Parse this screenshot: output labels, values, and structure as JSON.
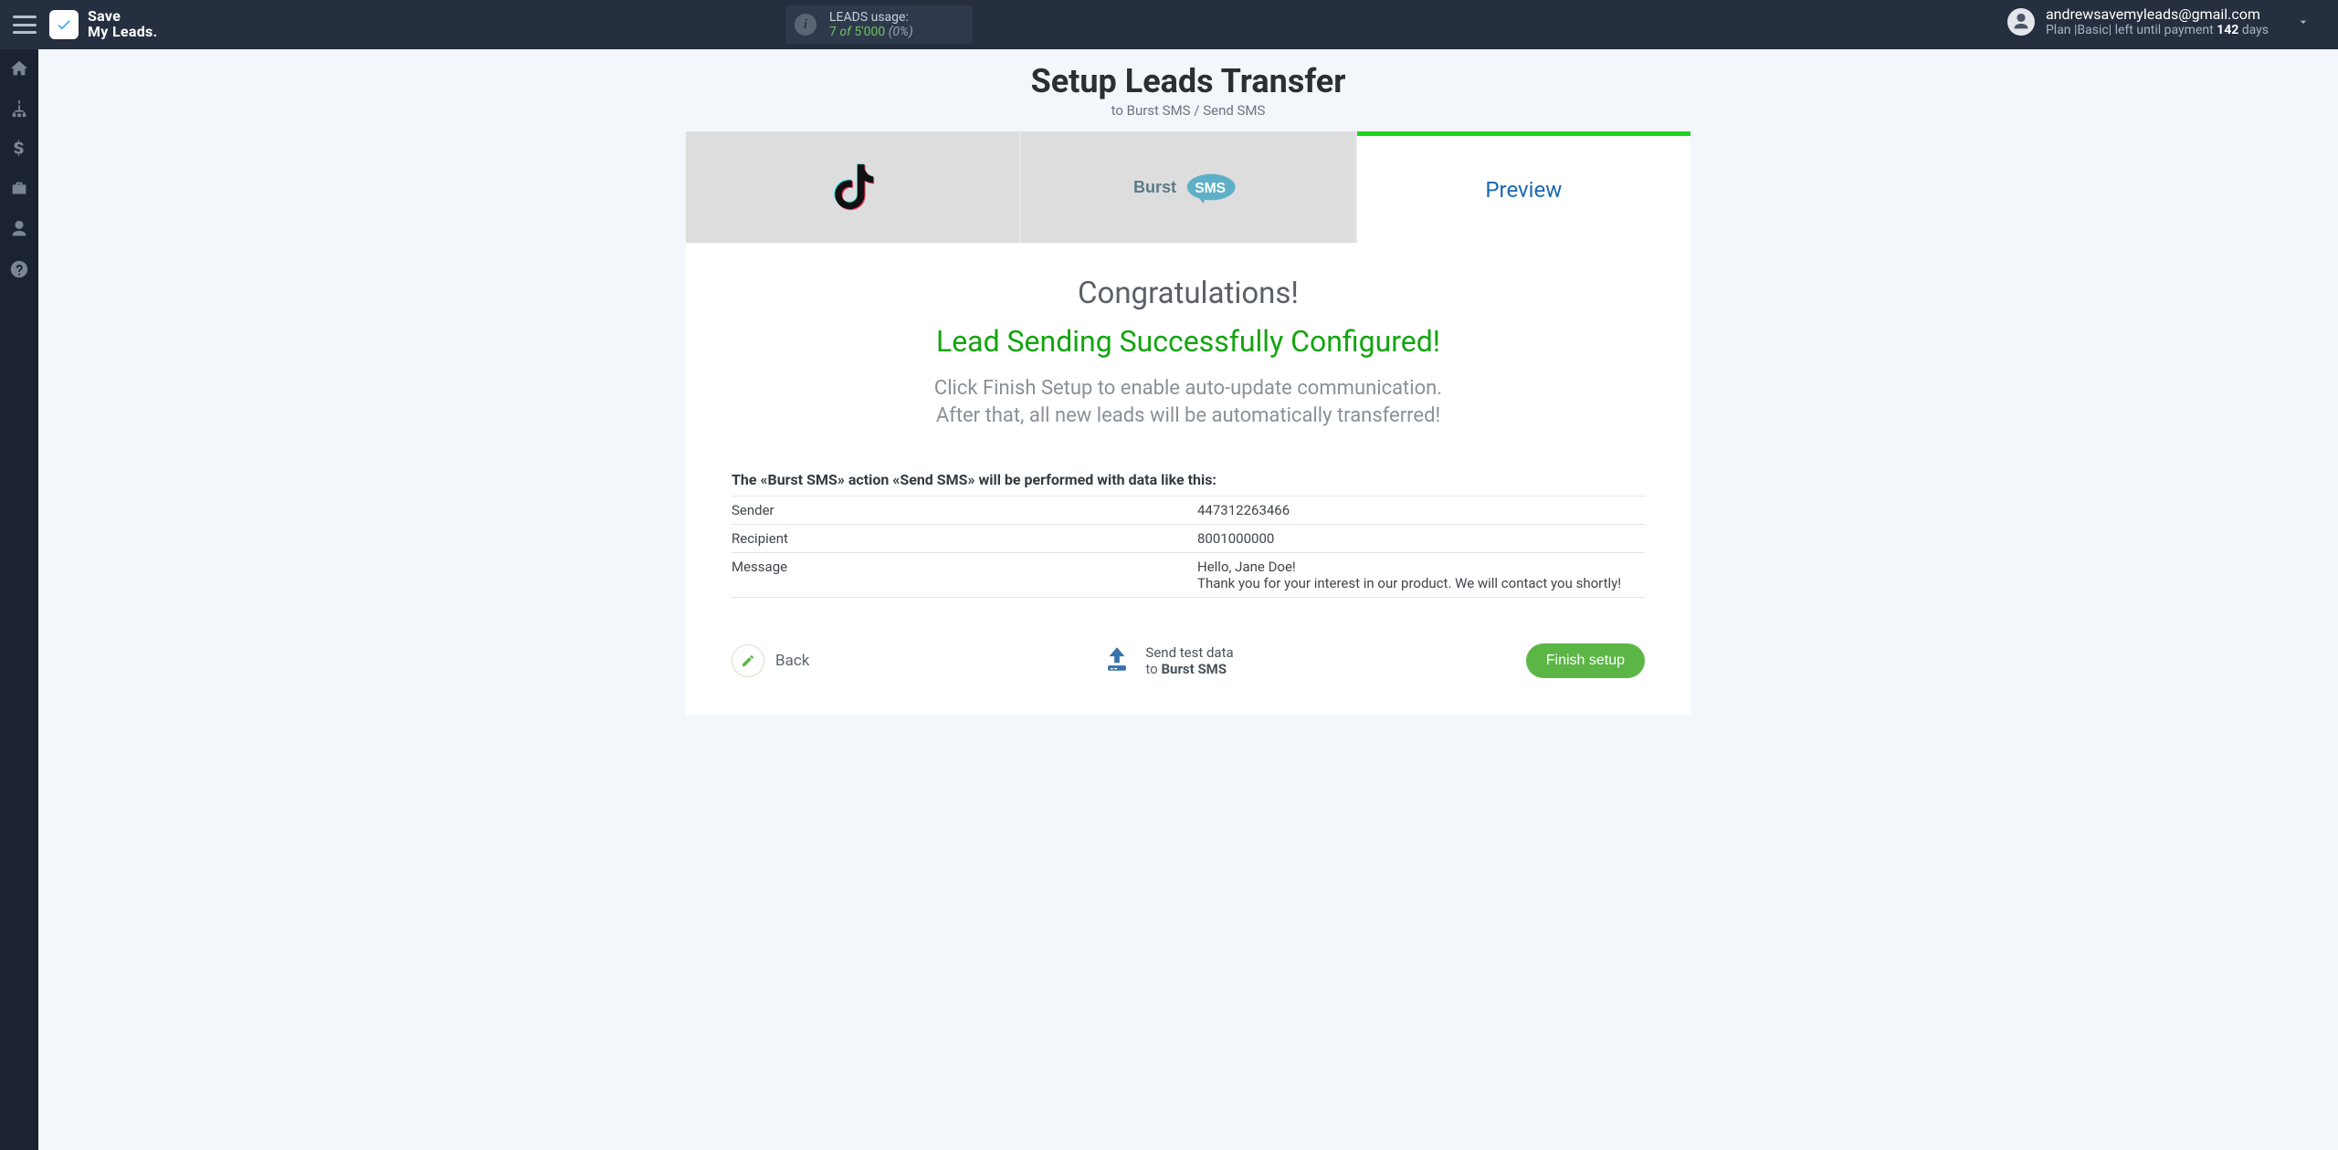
{
  "app": {
    "name_line1": "Save",
    "name_line2": "My Leads."
  },
  "header": {
    "leads_label": "LEADS usage:",
    "leads_used": "7",
    "leads_of": "of",
    "leads_total": "5'000",
    "leads_pct": "(0%)",
    "account_email": "andrewsavemyleads@gmail.com",
    "plan_prefix": "Plan |Basic| left until payment ",
    "plan_days_num": "142",
    "plan_days_word": " days"
  },
  "page": {
    "title": "Setup Leads Transfer",
    "subtitle": "to Burst SMS / Send SMS"
  },
  "tabs": {
    "preview_label": "Preview"
  },
  "content": {
    "congrats": "Congratulations!",
    "success": "Lead Sending Successfully Configured!",
    "explain_line1": "Click Finish Setup to enable auto-update communication.",
    "explain_line2": "After that, all new leads will be automatically transferred!",
    "action_caption": "The «Burst SMS» action «Send SMS» will be performed with data like this:",
    "rows": [
      {
        "k": "Sender",
        "v": "447312263466"
      },
      {
        "k": "Recipient",
        "v": "8001000000"
      },
      {
        "k": "Message",
        "v": "Hello, Jane Doe!\nThank you for your interest in our product. We will contact you shortly!"
      }
    ]
  },
  "footer": {
    "back_label": "Back",
    "send_line1": "Send test data",
    "send_line2_prefix": "to ",
    "send_line2_bold": "Burst SMS",
    "finish_label": "Finish setup"
  }
}
